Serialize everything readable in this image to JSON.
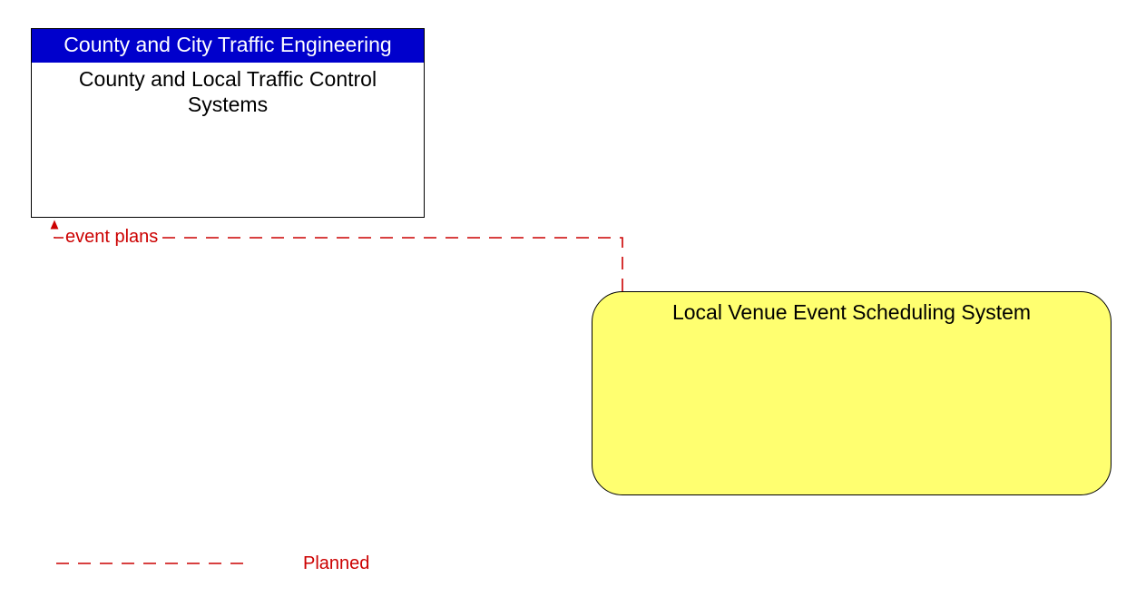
{
  "entities": {
    "county": {
      "header": "County and City Traffic Engineering",
      "title": "County and Local Traffic Control Systems"
    },
    "venue": {
      "title": "Local Venue Event Scheduling System"
    }
  },
  "flow": {
    "label": "event plans"
  },
  "legend": {
    "planned": "Planned"
  },
  "colors": {
    "header_bg": "#0000cc",
    "venue_bg": "#ffff70",
    "line": "#cc0000"
  }
}
